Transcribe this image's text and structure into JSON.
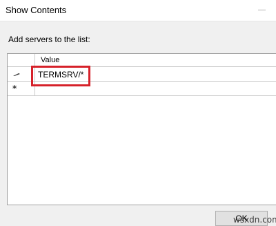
{
  "window": {
    "title": "Show Contents"
  },
  "prompt": {
    "text": "Add servers to the list:"
  },
  "grid": {
    "column_header": "Value",
    "rows": [
      {
        "marker": "pencil-icon",
        "value": "TERMSRV/*"
      },
      {
        "marker": "asterisk-icon",
        "value": ""
      }
    ],
    "new_row_marker": "*"
  },
  "buttons": {
    "ok_label": "OK"
  },
  "watermark": {
    "text": "wsxdn.com"
  },
  "colors": {
    "highlight": "#d6212a",
    "grid_border": "#a0a0a0",
    "window_bg": "#f0f0f0"
  }
}
